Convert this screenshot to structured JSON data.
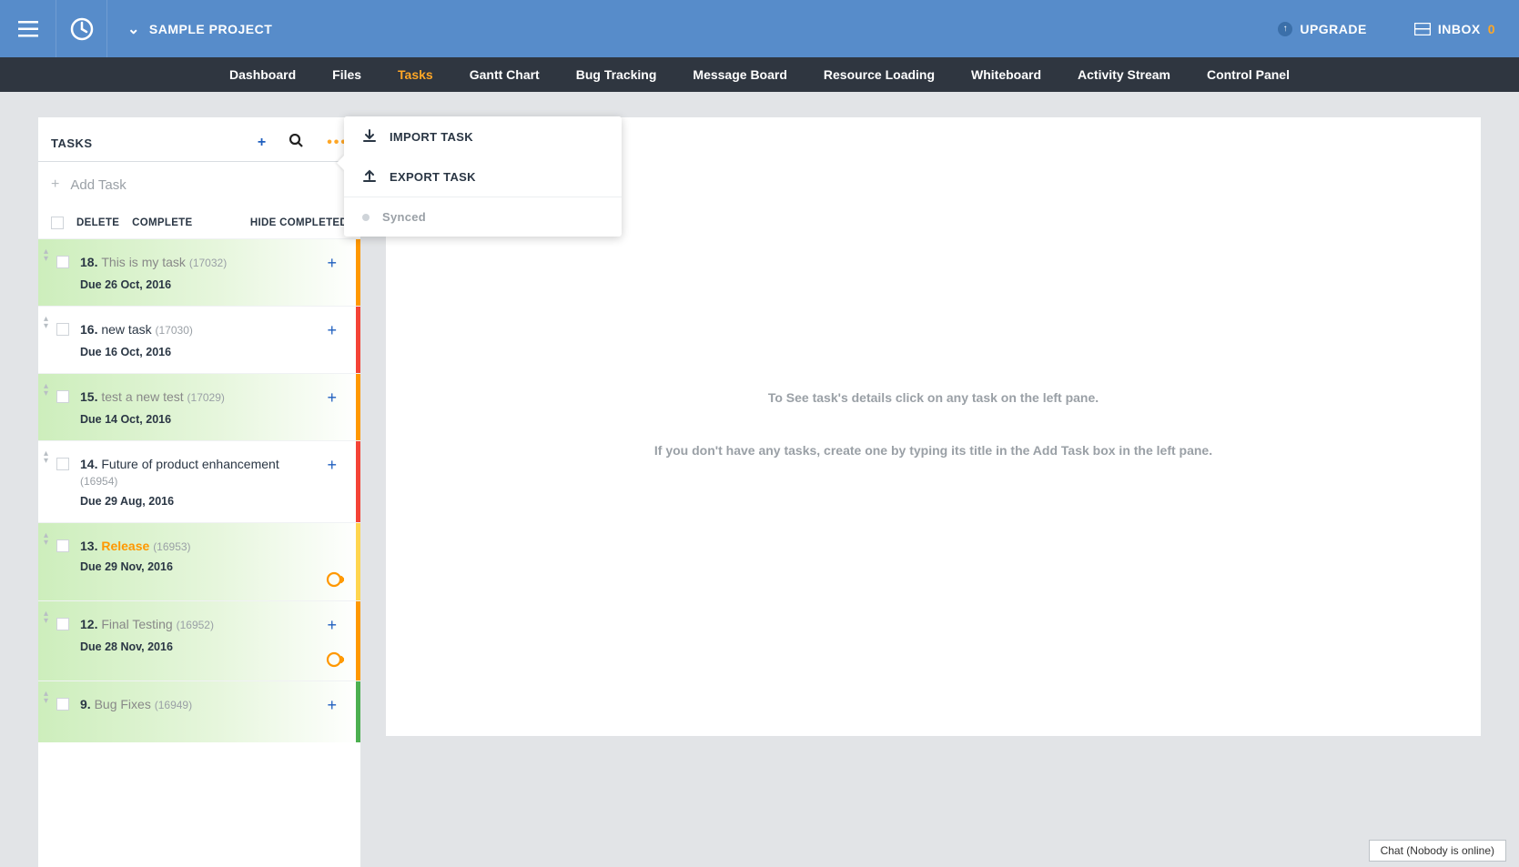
{
  "header": {
    "project_label": "SAMPLE PROJECT",
    "upgrade_label": "UPGRADE",
    "inbox_label": "INBOX",
    "inbox_count": "0"
  },
  "nav": {
    "items": [
      {
        "label": "Dashboard"
      },
      {
        "label": "Files"
      },
      {
        "label": "Tasks",
        "active": true
      },
      {
        "label": "Gantt Chart"
      },
      {
        "label": "Bug Tracking"
      },
      {
        "label": "Message Board"
      },
      {
        "label": "Resource Loading"
      },
      {
        "label": "Whiteboard"
      },
      {
        "label": "Activity Stream"
      },
      {
        "label": "Control Panel"
      }
    ]
  },
  "left": {
    "title": "TASKS",
    "add_task_placeholder": "Add Task",
    "toolbar": {
      "delete": "DELETE",
      "complete": "COMPLETE",
      "hide_completed": "HIDE COMPLETED"
    },
    "tasks": [
      {
        "num": "18.",
        "name": "This is my task",
        "id": "(17032)",
        "due": "Due 26 Oct, 2016",
        "bg": "green",
        "edge": "orange",
        "name_style": "gray",
        "recur": false,
        "plus": true
      },
      {
        "num": "16.",
        "name": "new task",
        "id": "(17030)",
        "due": "Due 16 Oct, 2016",
        "bg": "white",
        "edge": "red",
        "name_style": "dark",
        "recur": false,
        "plus": true
      },
      {
        "num": "15.",
        "name": "test a new test",
        "id": "(17029)",
        "due": "Due 14 Oct, 2016",
        "bg": "green",
        "edge": "orange",
        "name_style": "gray",
        "recur": false,
        "plus": true
      },
      {
        "num": "14.",
        "name": "Future of product enhancement",
        "id": "(16954)",
        "due": "Due 29 Aug, 2016",
        "bg": "white",
        "edge": "red",
        "name_style": "dark",
        "recur": false,
        "plus": true
      },
      {
        "num": "13.",
        "name": "Release",
        "id": "(16953)",
        "due": "Due 29 Nov, 2016",
        "bg": "green",
        "edge": "yellow",
        "name_style": "orange",
        "recur": true,
        "plus": false
      },
      {
        "num": "12.",
        "name": "Final Testing",
        "id": "(16952)",
        "due": "Due 28 Nov, 2016",
        "bg": "green",
        "edge": "orange",
        "name_style": "gray",
        "recur": true,
        "plus": true
      },
      {
        "num": "9.",
        "name": "Bug Fixes",
        "id": "(16949)",
        "due": "",
        "bg": "green",
        "edge": "green",
        "name_style": "gray",
        "recur": false,
        "plus": true
      }
    ]
  },
  "popover": {
    "import": "IMPORT TASK",
    "export": "EXPORT TASK",
    "synced": "Synced"
  },
  "right": {
    "line1": "To See task's details click on any task on the left pane.",
    "line2": "If you don't have any tasks, create one by typing its title in the Add Task box in the left pane."
  },
  "chat": "Chat (Nobody is online)"
}
